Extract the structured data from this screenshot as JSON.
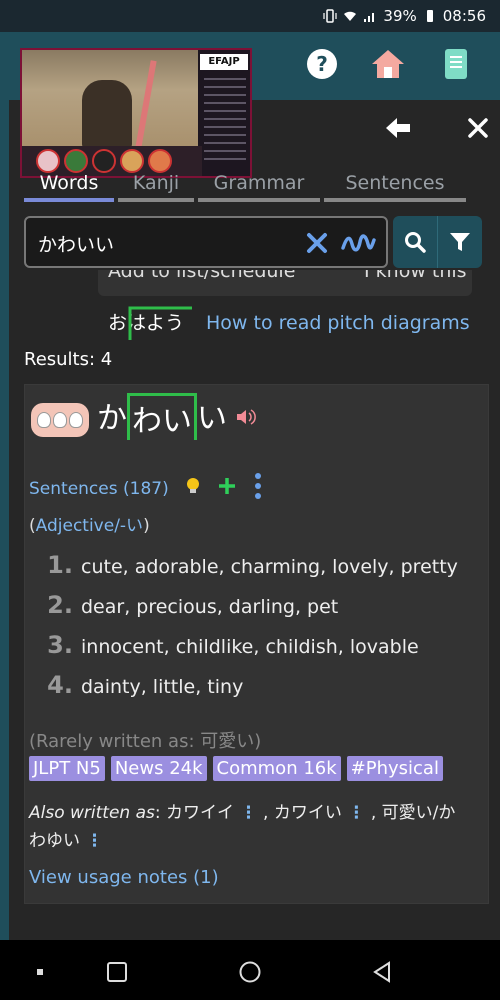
{
  "status_bar": {
    "battery": "39%",
    "time": "08:56"
  },
  "pip": {
    "logo_text": "EFAJP"
  },
  "tabs": [
    {
      "label": "Words",
      "active": true
    },
    {
      "label": "Kanji",
      "active": false
    },
    {
      "label": "Grammar",
      "active": false
    },
    {
      "label": "Sentences",
      "active": false
    }
  ],
  "search": {
    "value": "かわいい",
    "placeholder": ""
  },
  "hidden_row": {
    "left_text": "Add to list/schedule",
    "right_text": "I know this"
  },
  "pitch_help": {
    "example_kana": "おはよう",
    "link_label": "How to read pitch diagrams"
  },
  "results": {
    "label": "Results: 4"
  },
  "entry": {
    "word_chars": [
      "か",
      "わい",
      "い"
    ],
    "sentences_label": "Sentences (187)",
    "pos_open": "(",
    "pos_label": "Adjective/-い",
    "pos_close": ")",
    "definitions": [
      {
        "num": "1.",
        "text": "cute, adorable, charming, lovely, pretty"
      },
      {
        "num": "2.",
        "text": "dear, precious, darling, pet"
      },
      {
        "num": "3.",
        "text": "innocent, childlike, childish, lovable"
      },
      {
        "num": "4.",
        "text": "dainty, little, tiny"
      }
    ],
    "rarely": "(Rarely written as: 可愛い)",
    "tags": [
      "JLPT N5",
      "News 24k",
      "Common 16k",
      "#Physical"
    ],
    "also_label": "Also written as",
    "also_forms": [
      "カワイイ",
      "カワイい",
      "可愛い/かわゆい"
    ],
    "usage_notes": "View usage notes (1)"
  },
  "colors": {
    "accent": "#1f4e5b",
    "link": "#7fb7ee",
    "tag": "#9b8fe0",
    "pitch": "#2fbd4a"
  }
}
